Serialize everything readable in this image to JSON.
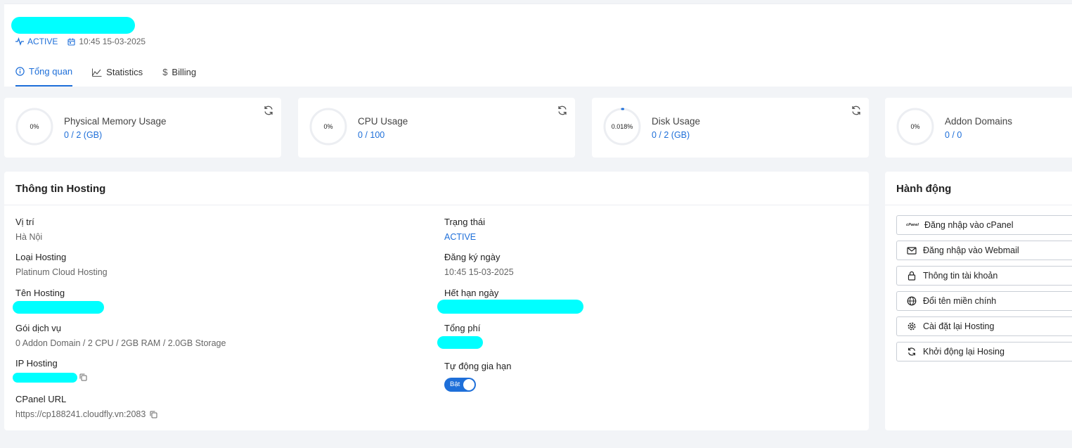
{
  "header": {
    "status": "ACTIVE",
    "datetime": "10:45 15-03-2025",
    "tabs": [
      {
        "label": "Tổng quan",
        "icon": "info-icon",
        "active": true
      },
      {
        "label": "Statistics",
        "icon": "chart-icon",
        "active": false
      },
      {
        "label": "Billing",
        "icon": "dollar-icon",
        "active": false
      }
    ]
  },
  "stats": [
    {
      "title": "Physical Memory Usage",
      "value": "0 / 2 (GB)",
      "percent": "0%",
      "fraction": 0
    },
    {
      "title": "CPU Usage",
      "value": "0 / 100",
      "percent": "0%",
      "fraction": 0
    },
    {
      "title": "Disk Usage",
      "value": "0 / 2 (GB)",
      "percent": "0.018%",
      "fraction": 0.00018
    },
    {
      "title": "Addon Domains",
      "value": "0 / 0",
      "percent": "0%",
      "fraction": 0
    }
  ],
  "info": {
    "title": "Thông tin Hosting",
    "location_label": "Vị trí",
    "location": "Hà Nội",
    "type_label": "Loại Hosting",
    "type": "Platinum Cloud Hosting",
    "name_label": "Tên Hosting",
    "package_label": "Gói dịch vụ",
    "package": "0 Addon Domain / 2 CPU / 2GB RAM / 2.0GB Storage",
    "ip_label": "IP Hosting",
    "cpanel_label": "CPanel URL",
    "cpanel_url": "https://cp188241.cloudfly.vn:2083",
    "status_label": "Trạng thái",
    "status": "ACTIVE",
    "registered_label": "Đăng ký ngày",
    "registered": "10:45 15-03-2025",
    "expiry_label": "Hết hạn ngày",
    "total_label": "Tổng phí",
    "autorenew_label": "Tự động gia hạn",
    "autorenew_state": "Bật"
  },
  "actions": {
    "title": "Hành động",
    "cpanel_badge": "cPanel",
    "items": [
      {
        "label": "Đăng nhập vào cPanel",
        "icon": "cpanel-icon"
      },
      {
        "label": "Đăng nhập vào Webmail",
        "icon": "mail-icon"
      },
      {
        "label": "Thông tin tài khoản",
        "icon": "lock-icon"
      },
      {
        "label": "Đổi tên miền chính",
        "icon": "globe-icon"
      },
      {
        "label": "Cài đặt lại Hosting",
        "icon": "gear-icon"
      },
      {
        "label": "Khởi động lại Hosing",
        "icon": "refresh-icon"
      }
    ]
  },
  "colors": {
    "accent": "#1e6fd9",
    "redaction": "#00ffff"
  }
}
